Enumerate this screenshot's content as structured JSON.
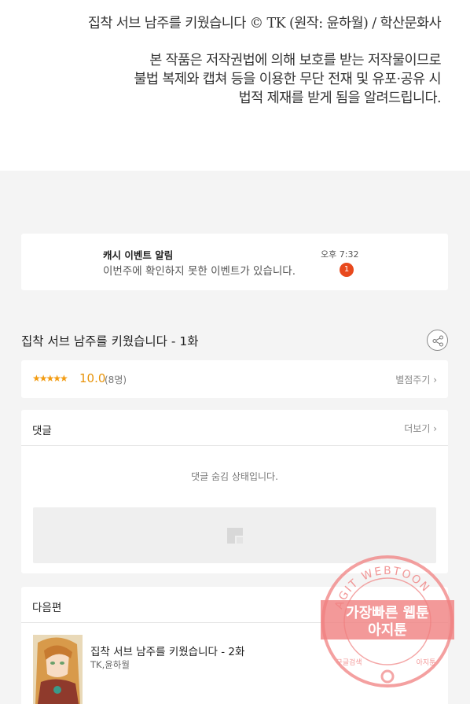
{
  "copyright": {
    "line1": "집착 서브 남주를 키웠습니다 © TK (원작: 윤하월) / 학산문화사",
    "line2": "본 작품은 저작권법에 의해 보호를 받는 저작물이므로",
    "line3": "불법 복제와 캡쳐 등을 이용한 무단 전재 및 유포·공유 시",
    "line4": "법적 제재를 받게 됨을 알려드립니다."
  },
  "notification": {
    "title": "캐시 이벤트 알림",
    "message": "이번주에 확인하지 못한 이벤트가 있습니다.",
    "time": "오후 7:32",
    "badge_count": "1"
  },
  "episode": {
    "title": "집착 서브 남주를 키웠습니다 - 1화",
    "share_icon": "share-icon"
  },
  "rating": {
    "stars": "★★★★★",
    "score": "10.0",
    "count": "(8명)",
    "rate_link": "별점주기 ›"
  },
  "comments": {
    "header": "댓글",
    "more_link": "더보기 ›",
    "hidden_message": "댓글 숨김 상태입니다."
  },
  "next_episode": {
    "header": "다음편",
    "title": "집착 서브 남주를 키웠습니다 - 2화",
    "author": "TK,윤하월"
  },
  "watermark": {
    "ring_text": "AGIT WEBTOON",
    "line1": "가장빠른 웹툰",
    "line2": "아지툰",
    "bottom_left": "구글검색",
    "bottom_right": "아지툰"
  },
  "colors": {
    "accent_orange": "#e8940b",
    "badge_red": "#e8491d",
    "watermark_pink": "#f08080"
  }
}
